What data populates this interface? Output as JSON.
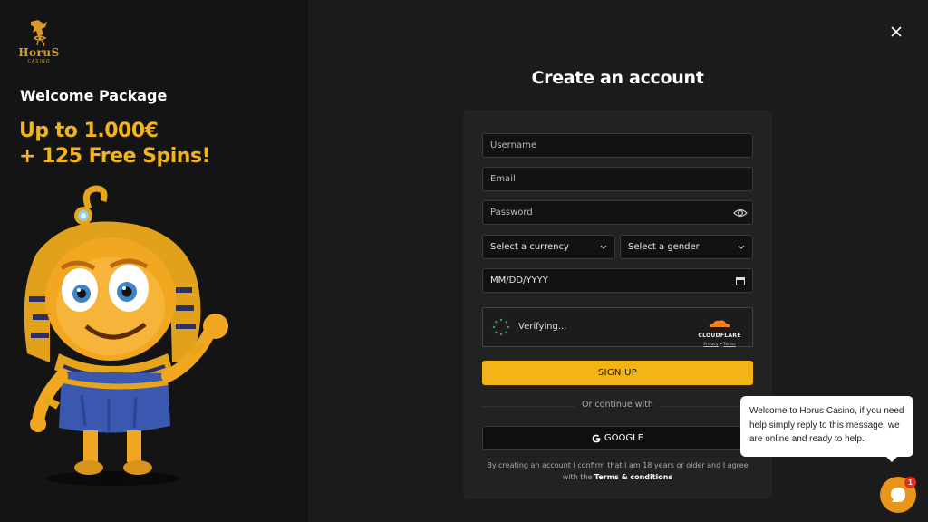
{
  "brand": {
    "name": "HoruS",
    "subtitle": "CASINO"
  },
  "promo": {
    "heading": "Welcome Package",
    "line1": "Up to 1.000€",
    "line2": "+ 125 Free Spins!"
  },
  "form": {
    "title": "Create an account",
    "username_placeholder": "Username",
    "email_placeholder": "Email",
    "password_placeholder": "Password",
    "currency_select": "Select a currency",
    "gender_select": "Select a gender",
    "date_placeholder": "MM/DD/YYYY",
    "captcha": {
      "status": "Verifying...",
      "provider": "CLOUDFLARE",
      "privacy": "Privacy",
      "separator": "•",
      "terms": "Terms"
    },
    "signup_label": "SIGN UP",
    "divider_text": "Or continue with",
    "google_label": "GOOGLE",
    "legal_prefix": "By creating an account I confirm that I am 18 years or older and I agree with the",
    "legal_link": "Terms & conditions"
  },
  "chat": {
    "message": "Welcome to Horus Casino, if you need help simply reply to this message, we are online and ready to help.",
    "badge_count": "1"
  },
  "colors": {
    "accent": "#f2b417",
    "background": "#1b1b1b",
    "left_panel": "#141414",
    "card": "#222222",
    "chat_button": "#e8951c",
    "badge": "#e0301e"
  },
  "icons": [
    "horus-eye-logo-icon",
    "close-icon",
    "eye-icon",
    "chevron-down-icon",
    "calendar-icon",
    "spinner-icon",
    "cloudflare-icon",
    "google-icon",
    "chat-icon"
  ]
}
